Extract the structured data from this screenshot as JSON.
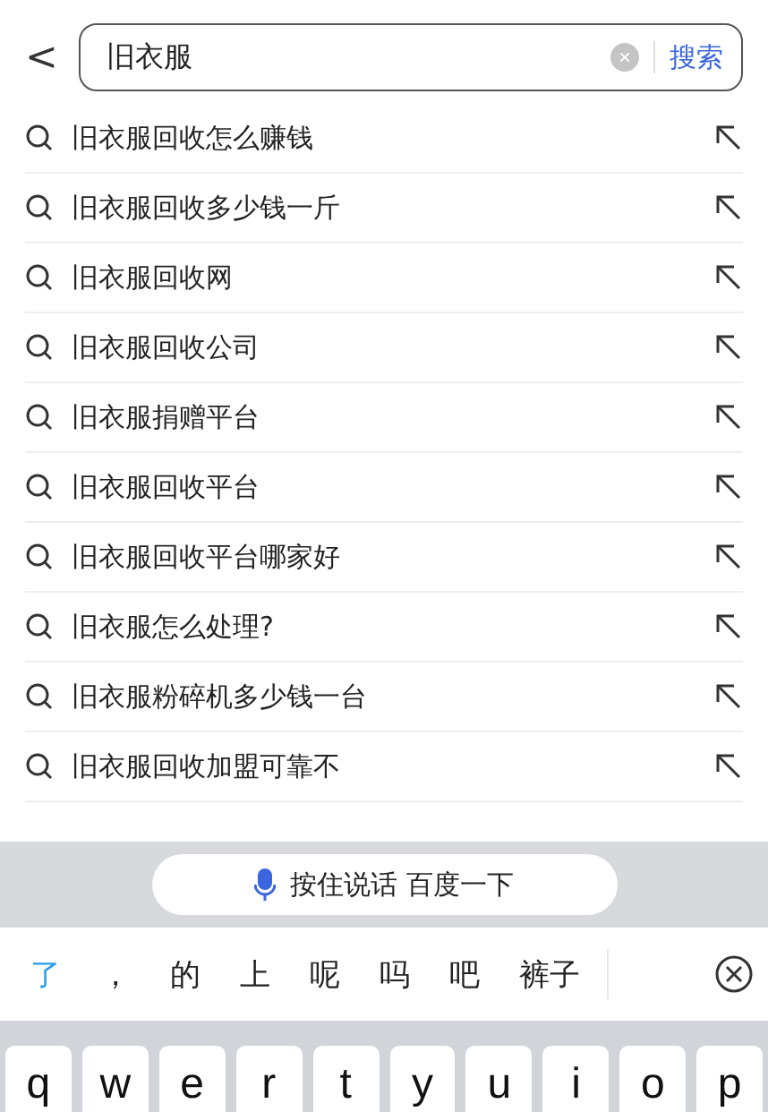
{
  "search": {
    "back": "<",
    "value": "旧衣服",
    "clear": "×",
    "button": "搜索"
  },
  "suggestions": [
    {
      "text": "旧衣服回收怎么赚钱"
    },
    {
      "text": "旧衣服回收多少钱一斤"
    },
    {
      "text": "旧衣服回收网"
    },
    {
      "text": "旧衣服回收公司"
    },
    {
      "text": "旧衣服捐赠平台"
    },
    {
      "text": "旧衣服回收平台"
    },
    {
      "text": "旧衣服回收平台哪家好"
    },
    {
      "text": "旧衣服怎么处理?"
    },
    {
      "text": "旧衣服粉碎机多少钱一台"
    },
    {
      "text": "旧衣服回收加盟可靠不"
    }
  ],
  "voice": {
    "label": "按住说话 百度一下"
  },
  "candidates": [
    {
      "text": "了",
      "selected": true
    },
    {
      "text": "，",
      "selected": false
    },
    {
      "text": "的",
      "selected": false
    },
    {
      "text": "上",
      "selected": false
    },
    {
      "text": "呢",
      "selected": false
    },
    {
      "text": "吗",
      "selected": false
    },
    {
      "text": "吧",
      "selected": false
    },
    {
      "text": "裤子",
      "selected": false
    }
  ],
  "keys": [
    "q",
    "w",
    "e",
    "r",
    "t",
    "y",
    "u",
    "i",
    "o",
    "p"
  ]
}
